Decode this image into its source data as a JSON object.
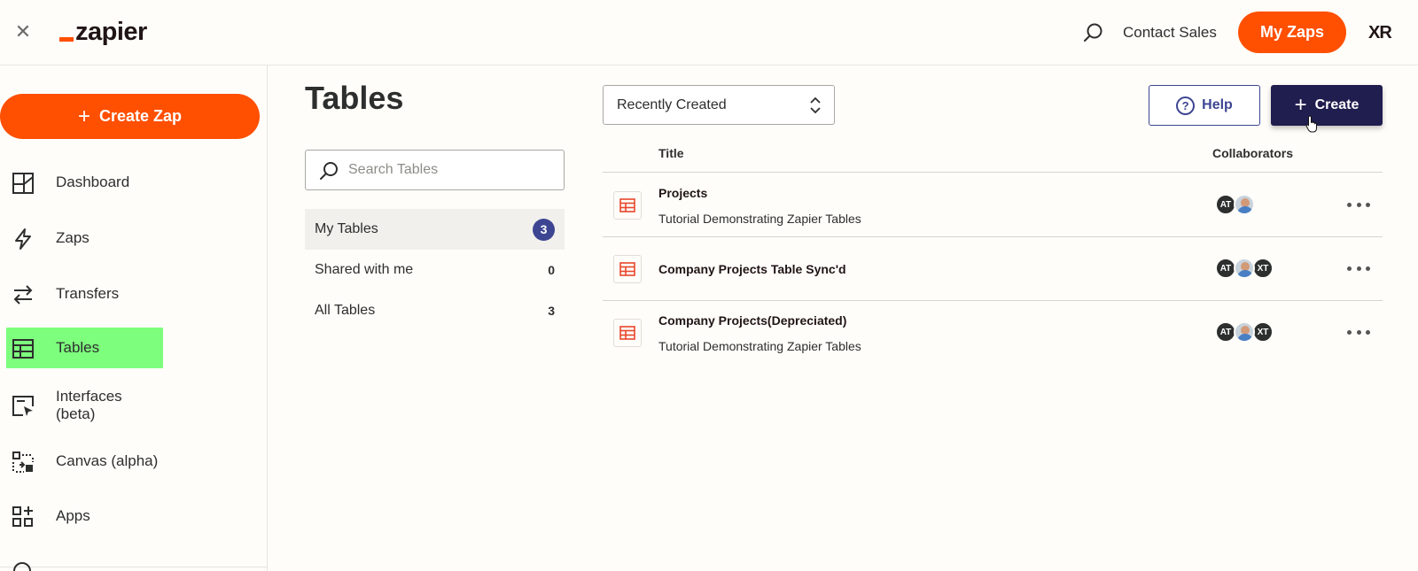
{
  "topbar": {
    "close_icon": "✕",
    "logo_text": "zapier",
    "contact_sales": "Contact Sales",
    "my_zaps": "My Zaps",
    "account_mark": "XR"
  },
  "sidebar": {
    "create_zap": "Create Zap",
    "items": [
      {
        "label": "Dashboard",
        "icon": "dashboard-icon"
      },
      {
        "label": "Zaps",
        "icon": "lightning-icon"
      },
      {
        "label": "Transfers",
        "icon": "transfer-arrows-icon"
      },
      {
        "label": "Tables",
        "icon": "table-icon",
        "active": true
      },
      {
        "label": "Interfaces (beta)",
        "icon": "interface-icon"
      },
      {
        "label": "Canvas (alpha)",
        "icon": "canvas-icon"
      },
      {
        "label": "Apps",
        "icon": "apps-icon"
      }
    ]
  },
  "tables_panel": {
    "title": "Tables",
    "search_placeholder": "Search Tables",
    "filters": [
      {
        "label": "My Tables",
        "count": "3",
        "selected": true
      },
      {
        "label": "Shared with me",
        "count": "0"
      },
      {
        "label": "All Tables",
        "count": "3"
      }
    ]
  },
  "toolbar": {
    "sort_value": "Recently Created",
    "help_label": "Help",
    "create_label": "Create"
  },
  "table_list": {
    "headers": {
      "title": "Title",
      "collaborators": "Collaborators"
    },
    "rows": [
      {
        "title": "Projects",
        "subtitle": "Tutorial Demonstrating Zapier Tables",
        "collaborators": [
          "AT",
          "photo"
        ]
      },
      {
        "title": "Company Projects Table Sync'd",
        "subtitle": "",
        "collaborators": [
          "AT",
          "photo",
          "XT"
        ]
      },
      {
        "title": "Company Projects(Depreciated)",
        "subtitle": "Tutorial Demonstrating Zapier Tables",
        "collaborators": [
          "AT",
          "photo",
          "XT"
        ]
      }
    ]
  },
  "colors": {
    "brand_orange": "#ff4f00",
    "active_nav_highlight": "#7dff7d",
    "primary_navy": "#201d4f",
    "badge_indigo": "#3d4592"
  }
}
